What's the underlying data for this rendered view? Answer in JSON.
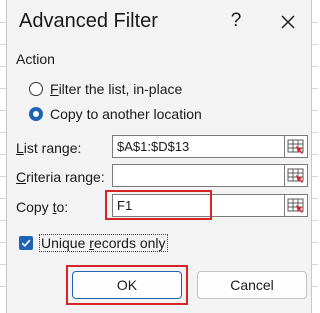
{
  "dialog": {
    "title": "Advanced Filter",
    "help_label": "?",
    "action_label": "Action",
    "options": [
      {
        "label_accel": "F",
        "label_rest": "ilter the list, in-place",
        "selected": false
      },
      {
        "label_accel": "O",
        "label_rest": "Copy to another location",
        "selected": true
      }
    ],
    "fields": {
      "list_range": {
        "label_accel": "L",
        "label_rest": "ist range:",
        "value": "$A$1:$D$13"
      },
      "criteria_range": {
        "label_accel": "C",
        "label_rest": "riteria range:",
        "value": ""
      },
      "copy_to": {
        "label_accel": "T",
        "label_rest": "Copy ",
        "label_tail": "o:",
        "value": "F1"
      }
    },
    "unique_records": {
      "label_accel": "R",
      "label_pre": "Unique ",
      "label_rest": "ecords only",
      "checked": true
    },
    "ok_label": "OK",
    "cancel_label": "Cancel"
  },
  "colors": {
    "accent": "#1f63b5",
    "highlight": "#d6242a",
    "dialog_bg": "#f3f3f3"
  },
  "icons": {
    "close": "close-icon",
    "range_selector": "range-selector-icon",
    "check": "checkmark-icon"
  }
}
